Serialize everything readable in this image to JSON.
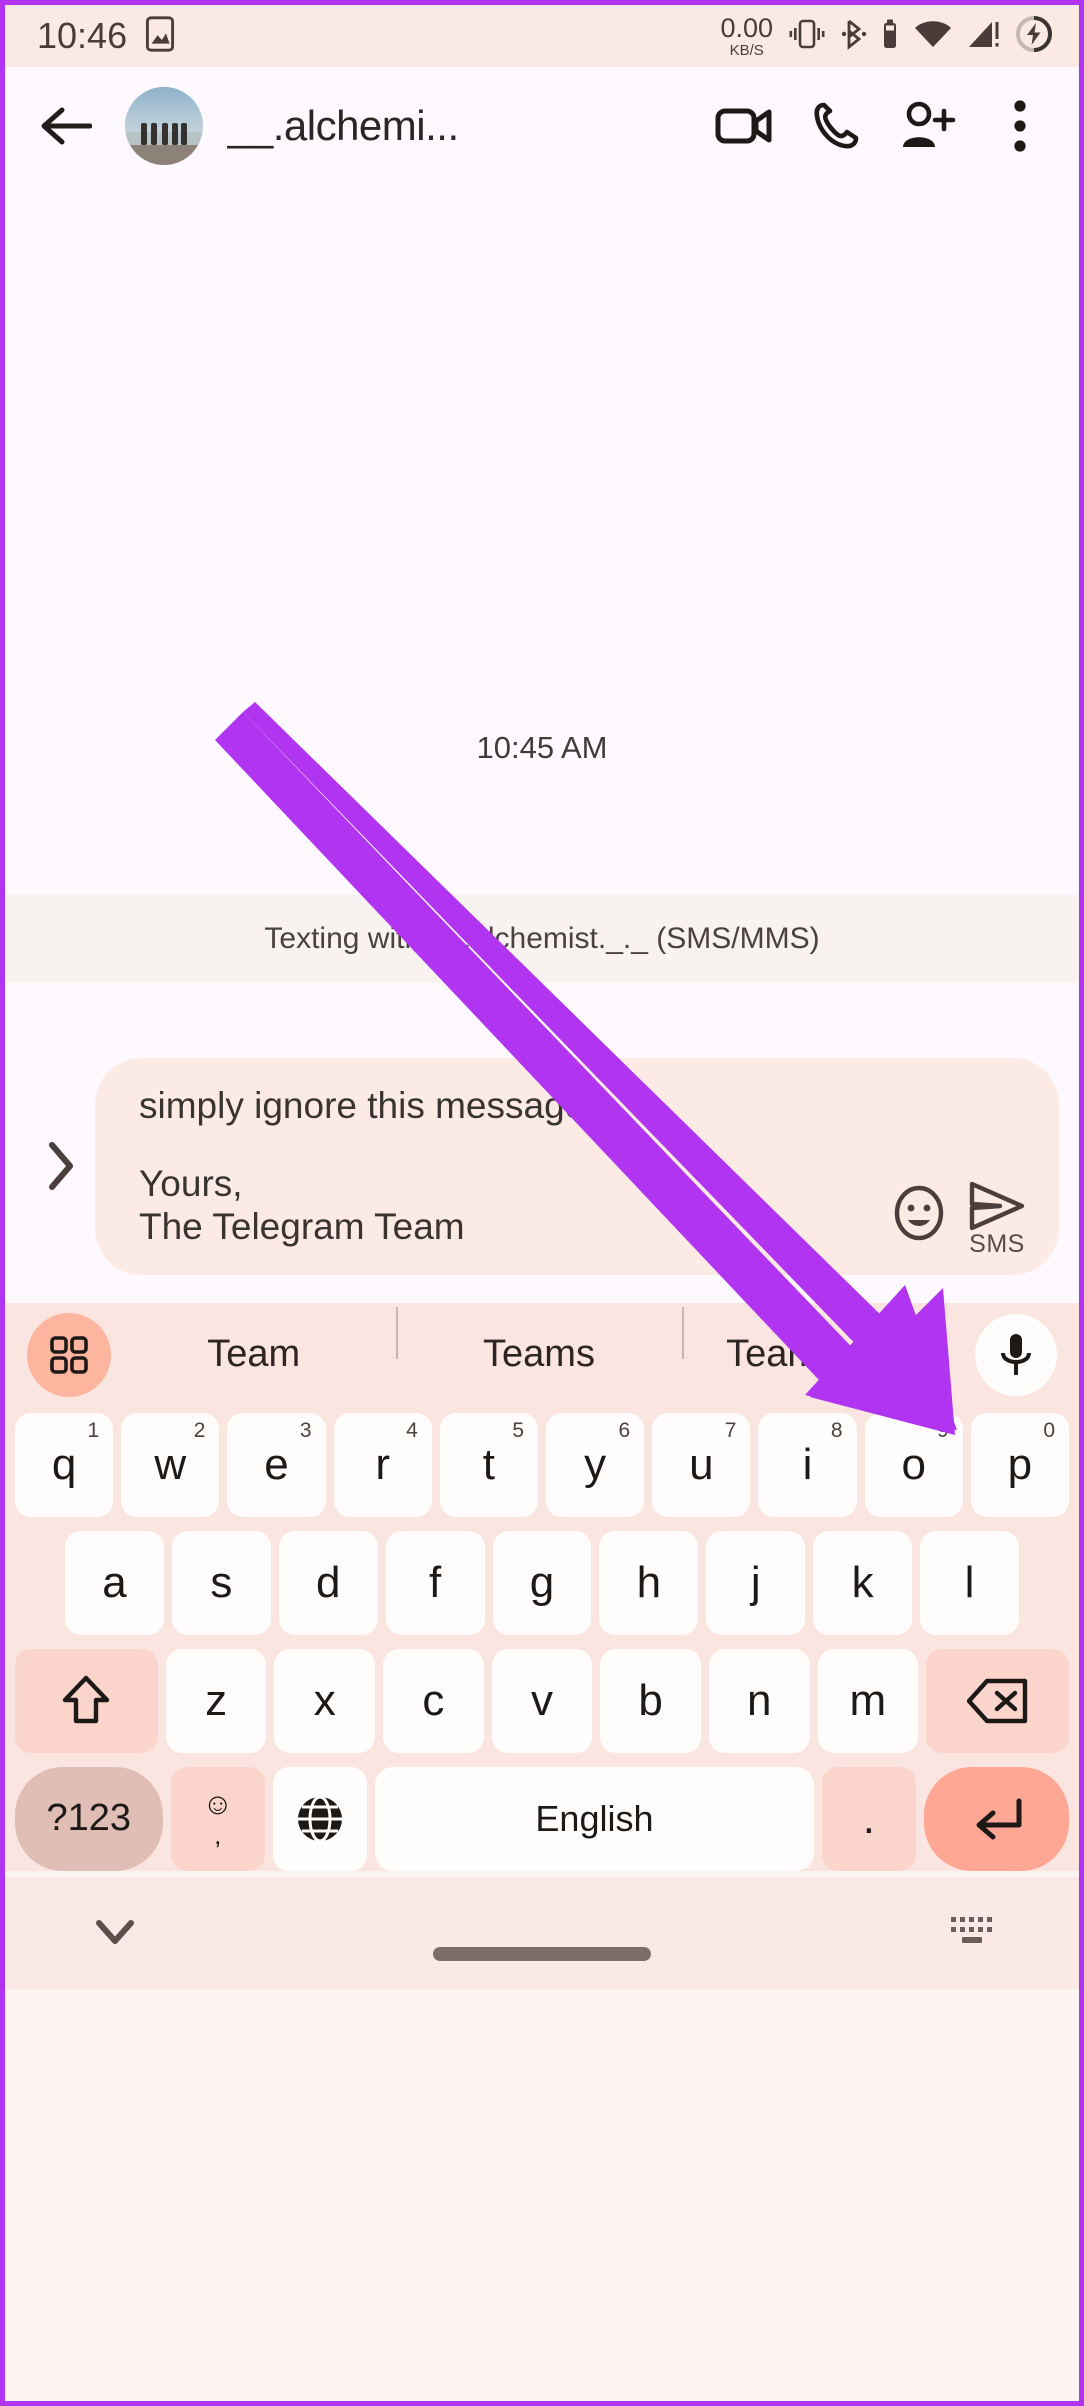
{
  "status_bar": {
    "time": "10:46",
    "data_rate": "0.00",
    "data_unit": "KB/S",
    "icons": [
      "image-icon",
      "vibrate-icon",
      "bluetooth-icon",
      "bluetooth-battery-icon",
      "wifi-icon",
      "cellular-signal-alert-icon",
      "battery-charging-icon"
    ]
  },
  "header": {
    "back_label": "←",
    "title": "__.alchemi...",
    "avatar_alt": "contact-avatar",
    "actions": [
      "video-call-icon",
      "phone-call-icon",
      "add-person-icon",
      "overflow-menu-icon"
    ]
  },
  "conversation": {
    "day_timestamp": "10:45 AM",
    "sms_banner": "Texting with __.alchemist._._ (SMS/MMS)"
  },
  "composer": {
    "expand_icon": "chevron-right-icon",
    "message_line_1": "simply ignore this message",
    "message_line_2": "Yours,",
    "message_line_3": "The Telegram Team",
    "emoji_icon": "smiley-face-icon",
    "send_icon": "send-paper-plane-icon",
    "send_label": "SMS"
  },
  "suggestions": {
    "apps_icon": "grid-apps-icon",
    "words": [
      "Team",
      "Teams",
      "Teammates"
    ],
    "mic_icon": "microphone-icon"
  },
  "keyboard": {
    "row1": [
      {
        "letter": "q",
        "sup": "1"
      },
      {
        "letter": "w",
        "sup": "2"
      },
      {
        "letter": "e",
        "sup": "3"
      },
      {
        "letter": "r",
        "sup": "4"
      },
      {
        "letter": "t",
        "sup": "5"
      },
      {
        "letter": "y",
        "sup": "6"
      },
      {
        "letter": "u",
        "sup": "7"
      },
      {
        "letter": "i",
        "sup": "8"
      },
      {
        "letter": "o",
        "sup": "9"
      },
      {
        "letter": "p",
        "sup": "0"
      }
    ],
    "row2": [
      "a",
      "s",
      "d",
      "f",
      "g",
      "h",
      "j",
      "k",
      "l"
    ],
    "row3_shift": "shift-up-arrow-icon",
    "row3": [
      "z",
      "x",
      "c",
      "v",
      "b",
      "n",
      "m"
    ],
    "row3_backspace": "backspace-icon",
    "row4": {
      "numbers_label": "?123",
      "emoji_top": "☺",
      "emoji_bottom": ",",
      "globe_icon": "language-globe-icon",
      "space_label": "English",
      "period_label": ".",
      "enter_icon": "enter-return-icon"
    }
  },
  "nav_bar": {
    "down_icon": "chevron-down-icon",
    "keyboard_icon": "hide-keyboard-icon",
    "home_pill": "home-gesture-pill"
  },
  "annotation": {
    "arrow_color": "#b034f0",
    "arrow_target": "send-button"
  },
  "colors": {
    "accent_purple": "#b034f0",
    "keyboard_bg": "#fbe5e0",
    "bubble_bg": "#fcebe5",
    "enter_key": "#fda794",
    "apps_circle": "#fdb5a0"
  }
}
